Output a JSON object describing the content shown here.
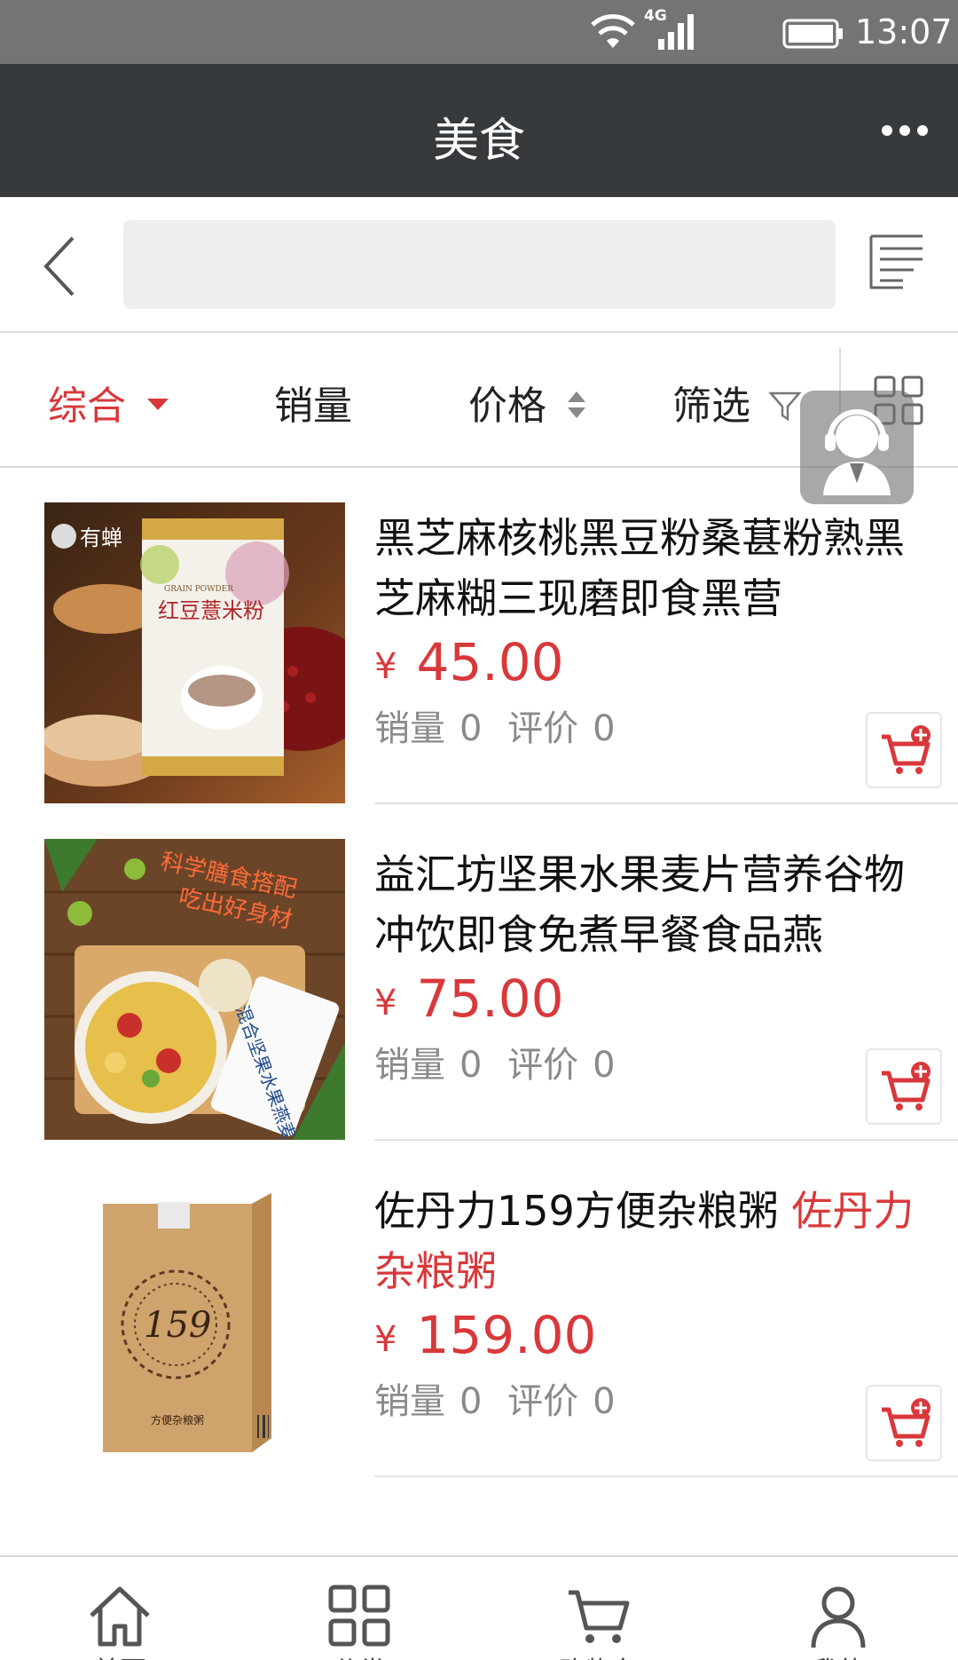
{
  "status_bar": {
    "network": "4G",
    "time": "13:07"
  },
  "header": {
    "title": "美食"
  },
  "search": {
    "value": "",
    "placeholder": ""
  },
  "filters": [
    {
      "label": "综合",
      "active": true
    },
    {
      "label": "销量",
      "active": false
    },
    {
      "label": "价格",
      "active": false
    },
    {
      "label": "筛选",
      "active": false
    }
  ],
  "products": [
    {
      "title": "黑芝麻核桃黑豆粉桑葚粉熟黑芝麻糊三现磨即食黑营",
      "title_highlight": "",
      "currency": "¥",
      "price": "45.00",
      "sales_label": "销量",
      "sales": "0",
      "reviews_label": "评价",
      "reviews": "0",
      "image_text_brand": "有蝉",
      "image_text_product": "红豆薏米粉",
      "image_text_sub": "GRAIN POWDER"
    },
    {
      "title": "益汇坊坚果水果麦片营养谷物冲饮即食免煮早餐食品燕",
      "title_highlight": "",
      "currency": "¥",
      "price": "75.00",
      "sales_label": "销量",
      "sales": "0",
      "reviews_label": "评价",
      "reviews": "0",
      "image_text_slogan1": "科学膳食搭配",
      "image_text_slogan2": "吃出好身材",
      "image_text_pack": "混合坚果水果燕麦"
    },
    {
      "title": "佐丹力159方便杂粮粥 ",
      "title_highlight": "佐丹力杂粮粥",
      "currency": "¥",
      "price": "159.00",
      "sales_label": "销量",
      "sales": "0",
      "reviews_label": "评价",
      "reviews": "0",
      "image_text_number": "159",
      "image_text_box": "方便杂粮粥"
    }
  ],
  "bottom_nav": [
    {
      "label": "首页",
      "icon": "home-icon"
    },
    {
      "label": "分类",
      "icon": "grid-icon"
    },
    {
      "label": "购物车",
      "icon": "cart-icon"
    },
    {
      "label": "我的",
      "icon": "user-icon"
    }
  ],
  "colors": {
    "accent": "#d9383b",
    "titlebar": "#373a3d",
    "statusbar": "#747474"
  }
}
